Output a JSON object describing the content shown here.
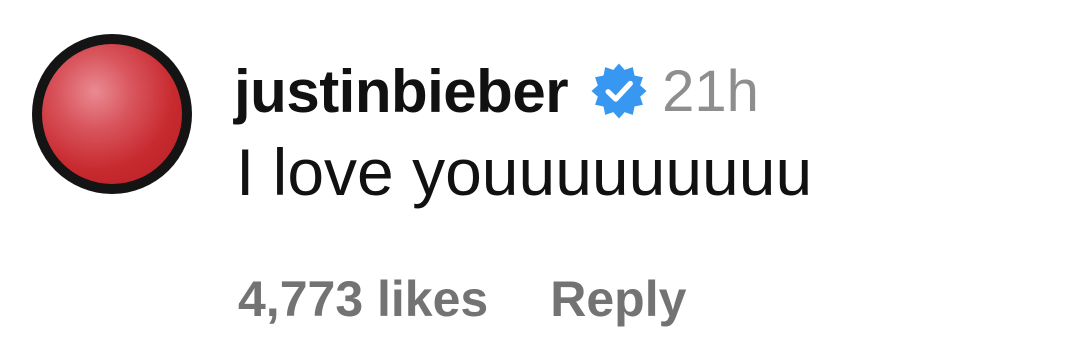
{
  "comment": {
    "username": "justinbieber",
    "verified_icon": "verified-badge-icon",
    "timestamp": "21h",
    "text": "I love youuuuuuuuu",
    "likes": "4,773 likes",
    "reply_label": "Reply"
  },
  "colors": {
    "verified_badge": "#3897f0",
    "secondary_text": "#737373",
    "timestamp_text": "#8e8e8e",
    "avatar_ring": "#141414",
    "avatar_fill": "#c72a2f"
  }
}
